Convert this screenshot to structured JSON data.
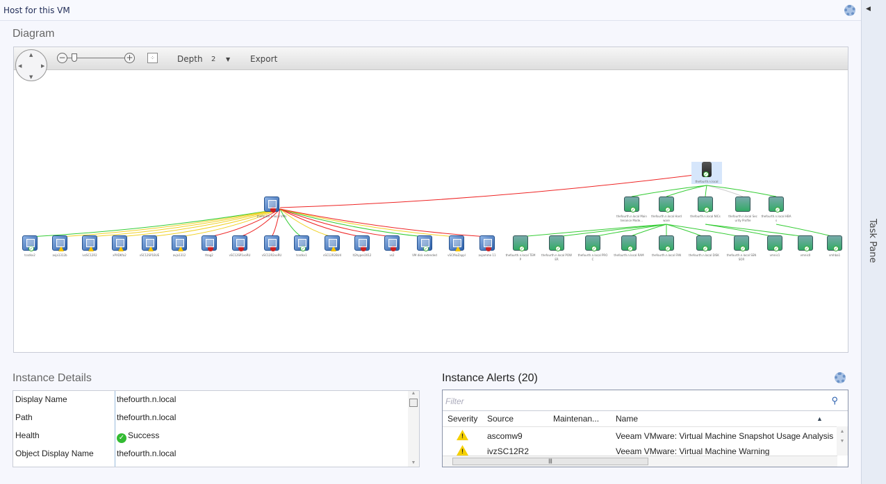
{
  "header": {
    "title": "Host for this VM"
  },
  "task_pane": {
    "label": "Task Pane"
  },
  "diagram": {
    "heading": "Diagram",
    "toolbar": {
      "depth_label": "Depth",
      "depth_value": "2",
      "export_label": "Export"
    },
    "host": {
      "label": "thefourth.n.local",
      "status": "success",
      "icon": "server-icon"
    },
    "vms_group": {
      "label": "thefourth.n.local VMs",
      "status": "critical",
      "icon": "vm-group-icon"
    },
    "vms": [
      {
        "label": "tcsdkv2",
        "status": "success"
      },
      {
        "label": "avja1312b",
        "status": "warning"
      },
      {
        "label": "ivzSC12R2",
        "status": "warning"
      },
      {
        "label": "xPXDKfa2",
        "status": "warning"
      },
      {
        "label": "vSC12SP1BUE",
        "status": "warning"
      },
      {
        "label": "avja1312",
        "status": "warning"
      },
      {
        "label": "thag2",
        "status": "critical"
      },
      {
        "label": "vSC12SP1voRU",
        "status": "critical"
      },
      {
        "label": "vSC12R2voRU",
        "status": "critical"
      },
      {
        "label": "tcsdkv1",
        "status": "success"
      },
      {
        "label": "vSC12R2BU4",
        "status": "warning"
      },
      {
        "label": "lt2hyper2012",
        "status": "critical"
      },
      {
        "label": "vs2",
        "status": "critical"
      },
      {
        "label": "VM disk extended",
        "status": "success"
      },
      {
        "label": "vSCfAaZappl",
        "status": "warning"
      },
      {
        "label": "avjamme 11",
        "status": "critical"
      }
    ],
    "host_children": [
      {
        "label": "thefourth.n.local Maintenance Mode...",
        "status": "success",
        "icon": "maintenance-icon"
      },
      {
        "label": "thefourth.n.local Hardware",
        "status": "success",
        "icon": "hardware-icon"
      },
      {
        "label": "thefourth.n.local NICs",
        "status": "success",
        "icon": "nic-icon"
      },
      {
        "label": "thefourth.n.local Security Profile",
        "status": "none",
        "icon": "security-lock-icon"
      },
      {
        "label": "thefourth.n.local HBAs",
        "status": "success",
        "icon": "hba-icon"
      }
    ],
    "hardware_children": [
      {
        "label": "thefourth.n.local TEMP",
        "status": "success",
        "icon": "thermometer-icon"
      },
      {
        "label": "thefourth.n.local POWER",
        "status": "success",
        "icon": "gauge-icon"
      },
      {
        "label": "thefourth.n.local PROC",
        "status": "success",
        "icon": "cpu-icon"
      },
      {
        "label": "thefourth.n.local RAM",
        "status": "success",
        "icon": "ram-icon"
      },
      {
        "label": "thefourth.n.local FAN",
        "status": "success",
        "icon": "fan-icon"
      },
      {
        "label": "thefourth.n.local DISK",
        "status": "success",
        "icon": "disk-icon"
      },
      {
        "label": "thefourth.n.local SENSOR",
        "status": "success",
        "icon": "sensor-icon"
      },
      {
        "label": "vmnic1",
        "status": "success",
        "icon": "nic-icon"
      },
      {
        "label": "vmnic0",
        "status": "success",
        "icon": "nic-icon"
      },
      {
        "label": "vmhba1",
        "status": "success",
        "icon": "hba-icon"
      }
    ],
    "colors": {
      "success": "#33cc33",
      "warning": "#f0d020",
      "critical": "#ee2222",
      "none": "#cccccc"
    }
  },
  "instance_details": {
    "heading": "Instance Details",
    "rows": [
      {
        "key": "Display Name",
        "value": "thefourth.n.local"
      },
      {
        "key": "Path",
        "value": "thefourth.n.local"
      },
      {
        "key": "Health",
        "value": "Success"
      },
      {
        "key": "Object Display Name",
        "value": "thefourth.n.local"
      }
    ]
  },
  "instance_alerts": {
    "heading": "Instance Alerts (20)",
    "filter_placeholder": "Filter",
    "columns": [
      "Severity",
      "Source",
      "Maintenan...",
      "Name"
    ],
    "rows": [
      {
        "severity": "warning",
        "source": "ascomw9",
        "maintenance": "",
        "name": "Veeam VMware: Virtual Machine Snapshot Usage Analysis"
      },
      {
        "severity": "warning",
        "source": "ivzSC12R2",
        "maintenance": "",
        "name": "Veeam VMware: Virtual Machine Warning"
      }
    ]
  }
}
